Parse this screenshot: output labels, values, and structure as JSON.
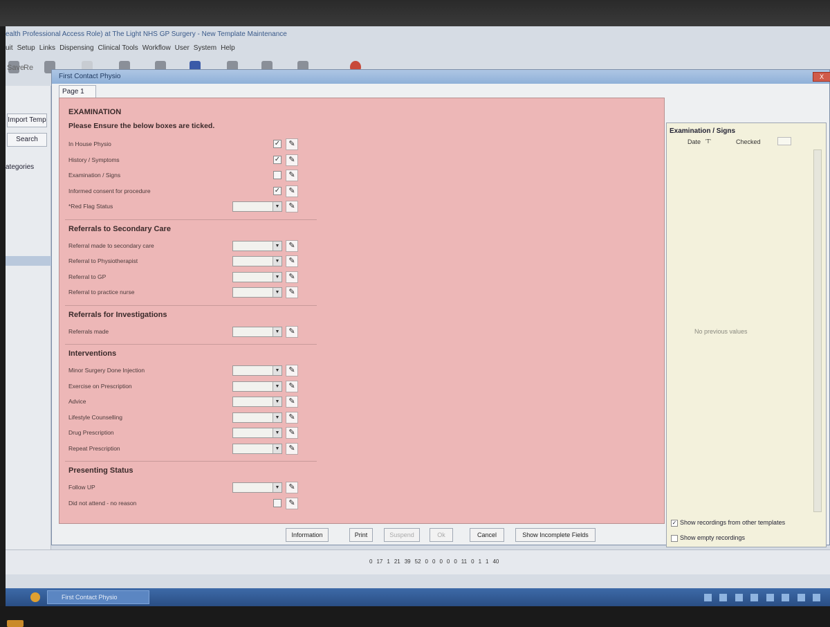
{
  "app": {
    "title": "ealth Professional Access Role) at The Light NHS GP Surgery - New Template Maintenance",
    "menu": [
      "uit",
      "Setup",
      "Links",
      "Dispensing",
      "Clinical Tools",
      "Workflow",
      "User",
      "System",
      "Help"
    ]
  },
  "left_panel": {
    "import_label": "Import Temp",
    "search_label": "Search",
    "categories_label": "ategories",
    "toolbar_labels": [
      "Save",
      "Re"
    ]
  },
  "dialog": {
    "title": "First Contact Physio",
    "tab_label": "Page 1",
    "close_label": "X"
  },
  "form": {
    "sections": [
      {
        "title": "EXAMINATION",
        "subtitle": "Please Ensure the below boxes are ticked.",
        "rows": [
          {
            "label": "In House Physio",
            "control": "checkbox",
            "checked": true
          },
          {
            "label": "History / Symptoms",
            "control": "checkbox",
            "checked": true
          },
          {
            "label": "Examination / Signs",
            "control": "checkbox",
            "checked": false
          },
          {
            "label": "Informed consent for procedure",
            "control": "checkbox",
            "checked": true
          },
          {
            "label": "*Red Flag Status",
            "control": "dropdown",
            "value": ""
          }
        ]
      },
      {
        "title": "Referrals to Secondary Care",
        "rows": [
          {
            "label": "Referral made to secondary care",
            "control": "dropdown",
            "value": ""
          },
          {
            "label": "Referral to Physiotherapist",
            "control": "dropdown",
            "value": ""
          },
          {
            "label": "Referral to GP",
            "control": "dropdown",
            "value": ""
          },
          {
            "label": "Referral to practice nurse",
            "control": "dropdown",
            "value": ""
          }
        ]
      },
      {
        "title": "Referrals for Investigations",
        "rows": [
          {
            "label": "Referrals made",
            "control": "dropdown",
            "value": ""
          }
        ]
      },
      {
        "title": "Interventions",
        "rows": [
          {
            "label": "Minor Surgery Done Injection",
            "control": "dropdown",
            "value": ""
          },
          {
            "label": "Exercise on Prescription",
            "control": "dropdown",
            "value": ""
          },
          {
            "label": "Advice",
            "control": "dropdown",
            "value": ""
          },
          {
            "label": "Lifestyle Counselling",
            "control": "dropdown",
            "value": ""
          },
          {
            "label": "Drug Prescription",
            "control": "dropdown",
            "value": ""
          },
          {
            "label": "Repeat Prescription",
            "control": "dropdown",
            "value": ""
          }
        ]
      },
      {
        "title": "Presenting Status",
        "rows": [
          {
            "label": "Follow UP",
            "control": "dropdown",
            "value": ""
          },
          {
            "label": "Did not attend - no reason",
            "control": "checkbox",
            "checked": false
          }
        ]
      }
    ]
  },
  "right_panel": {
    "title": "Examination / Signs",
    "col_date": "Date",
    "col_checked": "Checked",
    "empty_text": "No previous values",
    "show_other_templates": "Show recordings from other templates",
    "show_other_checked": true,
    "show_empty": "Show empty recordings",
    "show_empty_checked": false
  },
  "buttons": {
    "information": "Information",
    "print": "Print",
    "suspend": "Suspend",
    "ok": "Ok",
    "cancel": "Cancel",
    "show_incomplete": "Show Incomplete Fields"
  },
  "status_strip": [
    "0",
    "17",
    "1",
    "21",
    "39",
    "52",
    "0",
    "0",
    "0",
    "0",
    "0",
    "11",
    "0",
    "1",
    "1",
    "40"
  ],
  "taskbar": {
    "task_label": "First Contact Physio"
  }
}
